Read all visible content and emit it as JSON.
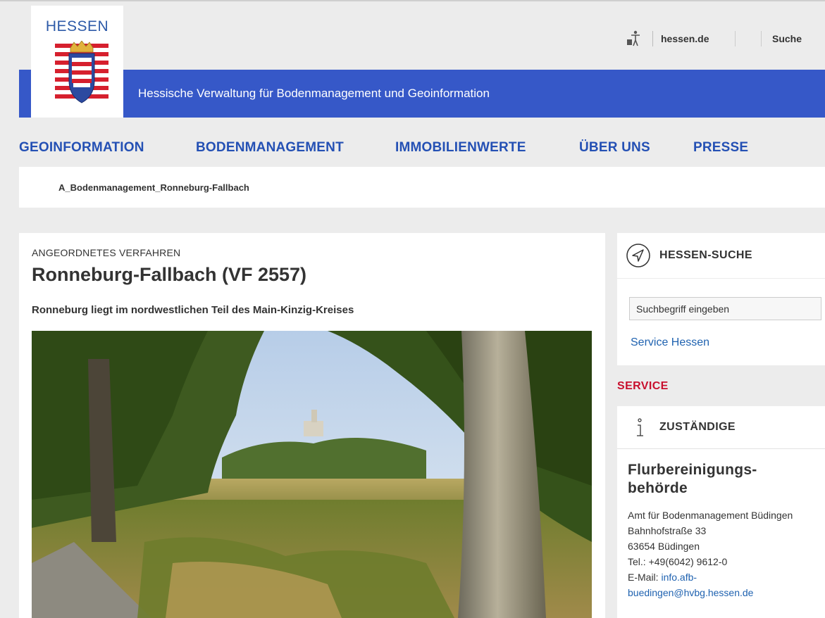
{
  "header": {
    "logo_text": "HESSEN",
    "agency_name": "Hessische Verwaltung für Bodenmanagement und Geoinformation",
    "utility": {
      "hessen_link": "hessen.de",
      "search_link": "Suche"
    }
  },
  "main_nav": {
    "items": [
      {
        "label": "GEOINFORMATION"
      },
      {
        "label": "BODENMANAGEMENT"
      },
      {
        "label": "IMMOBILIENWERTE"
      },
      {
        "label": "ÜBER UNS"
      },
      {
        "label": "PRESSE"
      }
    ]
  },
  "breadcrumb": {
    "current": "A_Bodenmanagement_Ronneburg-Fallbach"
  },
  "article": {
    "kicker": "ANGEORDNETES VERFAHREN",
    "title": "Ronneburg-Fallbach (VF 2557)",
    "teaser": "Ronneburg liegt im nordwestlichen Teil des Main-Kinzig-Kreises"
  },
  "sidebar": {
    "search": {
      "title": "HESSEN-SUCHE",
      "placeholder": "Suchbegriff eingeben",
      "service_link": "Service Hessen"
    },
    "service_label": "SERVICE",
    "contact": {
      "title": "ZUSTÄNDIGE",
      "office_title_line1": "Flurbereinigungs-",
      "office_title_line2": "behörde",
      "name": "Amt für Bodenmanagement Büdingen",
      "street": "Bahnhofstraße 33",
      "city": "63654 Büdingen",
      "phone": "Tel.: +49(6042) 9612-0",
      "email_label": "E-Mail: ",
      "email_line1": "info.afb-",
      "email_line2": "buedingen@hvbg.hessen.de"
    }
  },
  "colors": {
    "brand_blue": "#3658c8",
    "nav_blue": "#2450b4",
    "service_red": "#c8102e",
    "link_blue": "#1f62b0"
  }
}
